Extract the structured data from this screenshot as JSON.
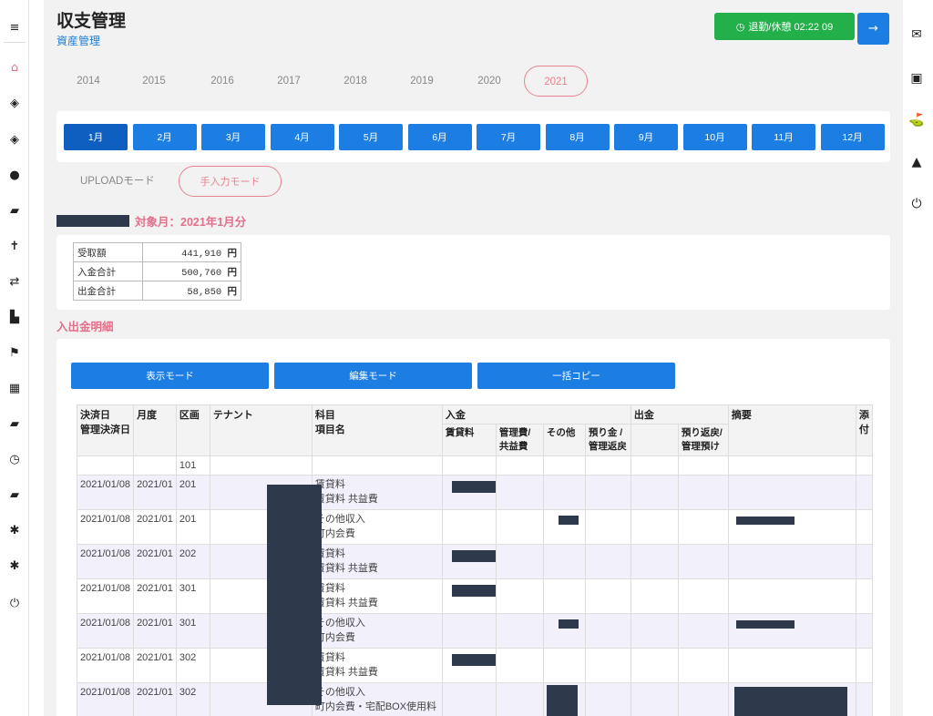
{
  "left_nav": [
    {
      "icon": "menu-icon",
      "glyph": "≡"
    },
    {
      "icon": "home-icon",
      "glyph": "⌂"
    },
    {
      "icon": "money-icon",
      "glyph": "◈"
    },
    {
      "icon": "money-stack-icon",
      "glyph": "◈"
    },
    {
      "icon": "users-icon",
      "glyph": "●"
    },
    {
      "icon": "wallet-icon",
      "glyph": "▰"
    },
    {
      "icon": "person-run-icon",
      "glyph": "✝"
    },
    {
      "icon": "exchange-icon",
      "glyph": "⇄"
    },
    {
      "icon": "building-icon",
      "glyph": "▙"
    },
    {
      "icon": "flag-icon",
      "glyph": "⚑"
    },
    {
      "icon": "calculator-icon",
      "glyph": "▦"
    },
    {
      "icon": "book-icon",
      "glyph": "▰"
    },
    {
      "icon": "clock-icon",
      "glyph": "◷"
    },
    {
      "icon": "notebook-icon",
      "glyph": "▰"
    },
    {
      "icon": "gear-icon",
      "glyph": "✱"
    },
    {
      "icon": "gear-icon",
      "glyph": "✱"
    },
    {
      "icon": "power-icon",
      "glyph": "⏻"
    }
  ],
  "right_nav": [
    {
      "icon": "mail-icon",
      "glyph": "✉"
    },
    {
      "icon": "calendar-icon",
      "glyph": "▣"
    },
    {
      "icon": "map-icon",
      "glyph": "⛳"
    },
    {
      "icon": "drive-icon",
      "glyph": "▲"
    },
    {
      "icon": "power-icon",
      "glyph": "⏻"
    }
  ],
  "header": {
    "title": "収支管理",
    "subtitle": "資産管理",
    "clock_label": "退勤/休憩 02:22 09",
    "clock_icon": "clock-icon",
    "next_glyph": "→"
  },
  "years": [
    "2014",
    "2015",
    "2016",
    "2017",
    "2018",
    "2019",
    "2020",
    "2021"
  ],
  "active_year": "2021",
  "months": [
    "1月",
    "2月",
    "3月",
    "4月",
    "5月",
    "6月",
    "7月",
    "8月",
    "9月",
    "10月",
    "11月",
    "12月"
  ],
  "active_month": "1月",
  "modes": {
    "upload": "UPLOADモード",
    "manual": "手入力モード"
  },
  "target_label": "対象月：2021年1月分",
  "summary": [
    {
      "label": "受取額",
      "value": "441,910",
      "unit": "円"
    },
    {
      "label": "入金合計",
      "value": "500,760",
      "unit": "円"
    },
    {
      "label": "出金合計",
      "value": "58,850",
      "unit": "円"
    }
  ],
  "detail_title": "入出金明細",
  "actions": {
    "view": "表示モード",
    "edit": "編集モード",
    "copy": "一括コピー"
  },
  "table_headers": {
    "date": "決済日",
    "date2": "管理決済日",
    "month": "月度",
    "section": "区画",
    "tenant": "テナント",
    "subject": "科目",
    "item": "項目名",
    "income": "入金",
    "rent": "賃貸料",
    "mgmt_fee_1": "管理費/",
    "mgmt_fee_2": "共益費",
    "other": "その他",
    "deposit_1": "預り金 /",
    "deposit_2": "管理返戻",
    "expense": "出金",
    "refund_1": "預り返戻/",
    "refund_2": "管理預け",
    "memo": "摘要",
    "attach_1": "添",
    "attach_2": "付"
  },
  "rows": [
    {
      "date": "",
      "month": "",
      "section": "101",
      "subject": "",
      "item": ""
    },
    {
      "date": "2021/01/08",
      "month": "2021/01",
      "section": "201",
      "subject": "賃貸料",
      "item": "賃貸料 共益費"
    },
    {
      "date": "2021/01/08",
      "month": "2021/01",
      "section": "201",
      "subject": "その他収入",
      "item": "町内会費"
    },
    {
      "date": "2021/01/08",
      "month": "2021/01",
      "section": "202",
      "subject": "賃貸料",
      "item": "賃貸料 共益費"
    },
    {
      "date": "2021/01/08",
      "month": "2021/01",
      "section": "301",
      "subject": "賃貸料",
      "item": "賃貸料 共益費"
    },
    {
      "date": "2021/01/08",
      "month": "2021/01",
      "section": "301",
      "subject": "その他収入",
      "item": "町内会費"
    },
    {
      "date": "2021/01/08",
      "month": "2021/01",
      "section": "302",
      "subject": "賃貸料",
      "item": "賃貸料 共益費"
    },
    {
      "date": "2021/01/08",
      "month": "2021/01",
      "section": "302",
      "subject": "その他収入",
      "item": "町内会費・宅配BOX使用料"
    }
  ],
  "colors": {
    "accent": "#1c7ee3",
    "pink": "#e3708a",
    "green": "#23b04a",
    "redact": "#2e3a4c"
  }
}
